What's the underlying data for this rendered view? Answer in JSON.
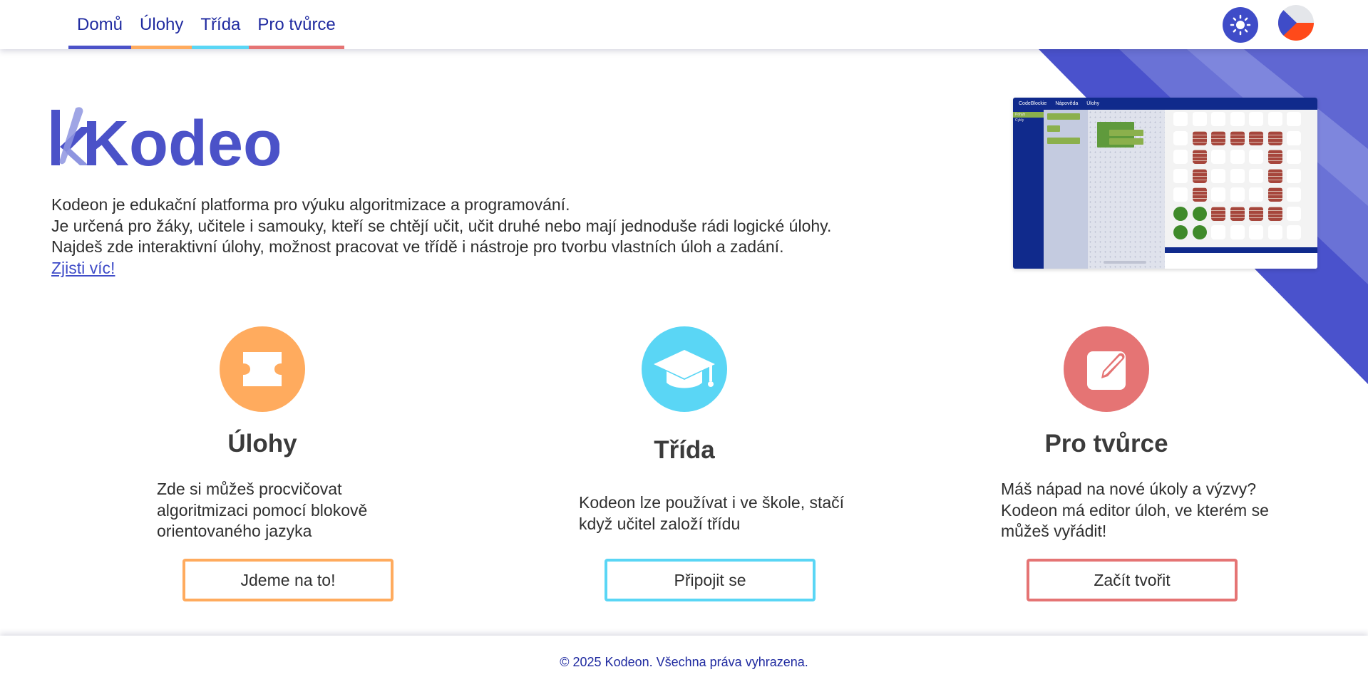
{
  "nav": {
    "items": [
      {
        "label": "Domů",
        "color": "#4b52c8"
      },
      {
        "label": "Úlohy",
        "color": "#ffab5e"
      },
      {
        "label": "Třída",
        "color": "#5ad6f5"
      },
      {
        "label": "Pro tvůrce",
        "color": "#e57474"
      }
    ],
    "theme_icon": "sun-icon",
    "language_icon": "czech-flag-icon"
  },
  "hero": {
    "logo_text": "Kodeon",
    "lines": [
      "Kodeon je edukační platforma pro výuku algoritmizace a programování.",
      "Je určená pro žáky, učitele i samouky, kteří se chtějí učit, učit druhé nebo mají jednoduše rádi logické úlohy.",
      "Najdeš zde interaktivní úlohy, možnost pracovat ve třídě i nástroje pro tvorbu vlastních úloh a zadání."
    ],
    "link_text": "Zjisti víc!"
  },
  "preview": {
    "menu": [
      "CodeBlockie",
      "Nápověda",
      "Úlohy"
    ],
    "categories": [
      "Pohyb",
      "Cykly"
    ]
  },
  "cards": [
    {
      "title": "Úlohy",
      "lines": [
        "Zde si můžeš procvičovat",
        "algoritmizaci pomocí blokově",
        "orientovaného jazyka"
      ],
      "button": "Jdeme na to!",
      "color": "#ffab5e",
      "icon": "puzzle-piece-icon"
    },
    {
      "title": "Třída",
      "lines": [
        "Kodeon lze používat i ve škole, stačí",
        "když učitel založí třídu"
      ],
      "button": "Připojit se",
      "color": "#5ad6f5",
      "icon": "graduation-cap-icon"
    },
    {
      "title": "Pro tvůrce",
      "lines": [
        "Máš nápad na nové úkoly a výzvy?",
        "Kodeon má editor úloh, ve kterém se",
        "můžeš vyřádit!"
      ],
      "button": "Začít tvořit",
      "color": "#e57474",
      "icon": "edit-pencil-icon"
    }
  ],
  "footer": {
    "text": "© 2025 Kodeon. Všechna práva vyhrazena."
  }
}
